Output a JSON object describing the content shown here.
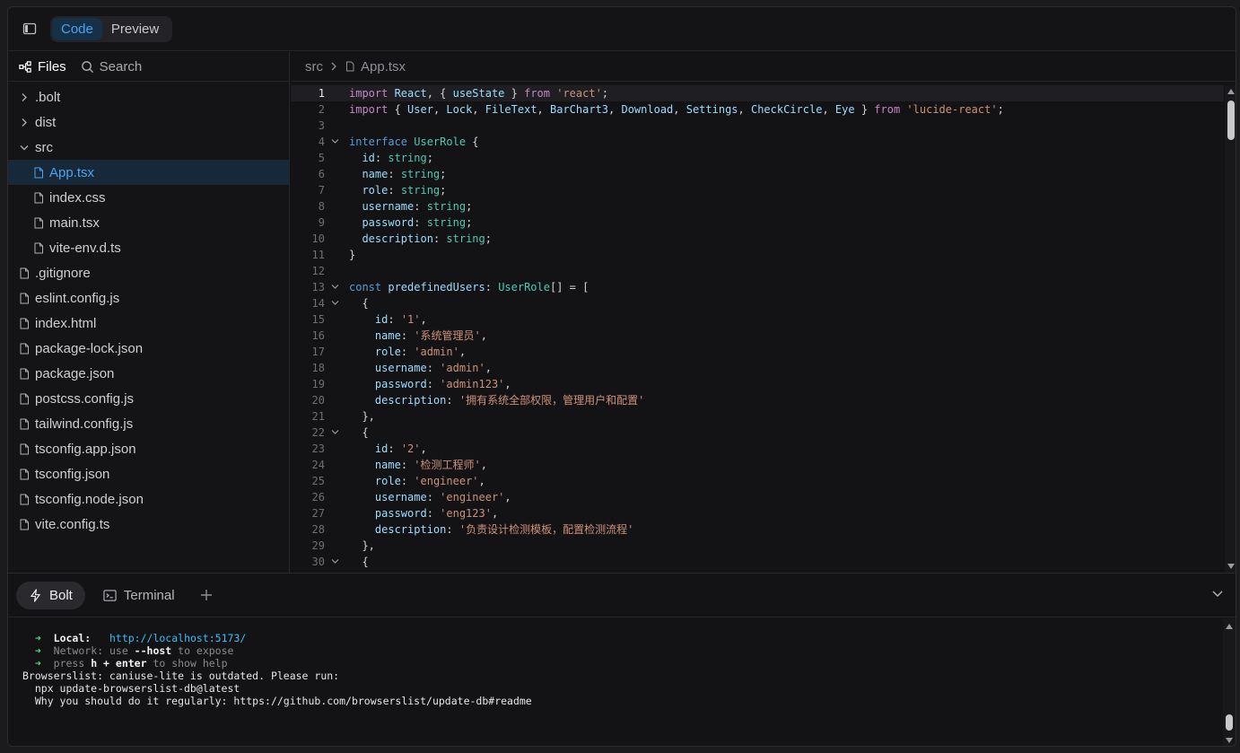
{
  "toolbar": {
    "tabs": [
      {
        "label": "Code",
        "active": true
      },
      {
        "label": "Preview",
        "active": false
      }
    ]
  },
  "files_panel": {
    "tabs": [
      {
        "label": "Files",
        "icon": "tree-icon",
        "active": true
      },
      {
        "label": "Search",
        "icon": "search-icon",
        "active": false
      }
    ],
    "tree": [
      {
        "label": ".bolt",
        "type": "folder",
        "expanded": false,
        "depth": 0
      },
      {
        "label": "dist",
        "type": "folder",
        "expanded": false,
        "depth": 0
      },
      {
        "label": "src",
        "type": "folder",
        "expanded": true,
        "depth": 0
      },
      {
        "label": "App.tsx",
        "type": "file",
        "depth": 1,
        "selected": true
      },
      {
        "label": "index.css",
        "type": "file",
        "depth": 1
      },
      {
        "label": "main.tsx",
        "type": "file",
        "depth": 1
      },
      {
        "label": "vite-env.d.ts",
        "type": "file",
        "depth": 1
      },
      {
        "label": ".gitignore",
        "type": "file",
        "depth": 0
      },
      {
        "label": "eslint.config.js",
        "type": "file",
        "depth": 0
      },
      {
        "label": "index.html",
        "type": "file",
        "depth": 0
      },
      {
        "label": "package-lock.json",
        "type": "file",
        "depth": 0
      },
      {
        "label": "package.json",
        "type": "file",
        "depth": 0
      },
      {
        "label": "postcss.config.js",
        "type": "file",
        "depth": 0
      },
      {
        "label": "tailwind.config.js",
        "type": "file",
        "depth": 0
      },
      {
        "label": "tsconfig.app.json",
        "type": "file",
        "depth": 0
      },
      {
        "label": "tsconfig.json",
        "type": "file",
        "depth": 0
      },
      {
        "label": "tsconfig.node.json",
        "type": "file",
        "depth": 0
      },
      {
        "label": "vite.config.ts",
        "type": "file",
        "depth": 0
      }
    ]
  },
  "editor": {
    "breadcrumb": {
      "folder": "src",
      "file": "App.tsx"
    },
    "current_line": 1,
    "lines": [
      {
        "n": "1",
        "fold": false,
        "tokens": [
          [
            "kw",
            "import "
          ],
          [
            "id",
            "React"
          ],
          [
            "pn",
            ", { "
          ],
          [
            "id",
            "useState"
          ],
          [
            "pn",
            " } "
          ],
          [
            "kw",
            "from "
          ],
          [
            "st",
            "'react'"
          ],
          [
            "pn",
            ";"
          ]
        ]
      },
      {
        "n": "2",
        "fold": false,
        "tokens": [
          [
            "kw",
            "import "
          ],
          [
            "pn",
            "{ "
          ],
          [
            "id",
            "User"
          ],
          [
            "pn",
            ", "
          ],
          [
            "id",
            "Lock"
          ],
          [
            "pn",
            ", "
          ],
          [
            "id",
            "FileText"
          ],
          [
            "pn",
            ", "
          ],
          [
            "id",
            "BarChart3"
          ],
          [
            "pn",
            ", "
          ],
          [
            "id",
            "Download"
          ],
          [
            "pn",
            ", "
          ],
          [
            "id",
            "Settings"
          ],
          [
            "pn",
            ", "
          ],
          [
            "id",
            "CheckCircle"
          ],
          [
            "pn",
            ", "
          ],
          [
            "id",
            "Eye"
          ],
          [
            "pn",
            " } "
          ],
          [
            "kw",
            "from "
          ],
          [
            "st",
            "'lucide-react'"
          ],
          [
            "pn",
            ";"
          ]
        ]
      },
      {
        "n": "3",
        "fold": false,
        "tokens": []
      },
      {
        "n": "4",
        "fold": true,
        "tokens": [
          [
            "kb",
            "interface "
          ],
          [
            "ty",
            "UserRole"
          ],
          [
            "pn",
            " {"
          ]
        ]
      },
      {
        "n": "5",
        "fold": false,
        "tokens": [
          [
            "pn",
            "  "
          ],
          [
            "id",
            "id"
          ],
          [
            "pn",
            ": "
          ],
          [
            "ty",
            "string"
          ],
          [
            "pn",
            ";"
          ]
        ]
      },
      {
        "n": "6",
        "fold": false,
        "tokens": [
          [
            "pn",
            "  "
          ],
          [
            "id",
            "name"
          ],
          [
            "pn",
            ": "
          ],
          [
            "ty",
            "string"
          ],
          [
            "pn",
            ";"
          ]
        ]
      },
      {
        "n": "7",
        "fold": false,
        "tokens": [
          [
            "pn",
            "  "
          ],
          [
            "id",
            "role"
          ],
          [
            "pn",
            ": "
          ],
          [
            "ty",
            "string"
          ],
          [
            "pn",
            ";"
          ]
        ]
      },
      {
        "n": "8",
        "fold": false,
        "tokens": [
          [
            "pn",
            "  "
          ],
          [
            "id",
            "username"
          ],
          [
            "pn",
            ": "
          ],
          [
            "ty",
            "string"
          ],
          [
            "pn",
            ";"
          ]
        ]
      },
      {
        "n": "9",
        "fold": false,
        "tokens": [
          [
            "pn",
            "  "
          ],
          [
            "id",
            "password"
          ],
          [
            "pn",
            ": "
          ],
          [
            "ty",
            "string"
          ],
          [
            "pn",
            ";"
          ]
        ]
      },
      {
        "n": "10",
        "fold": false,
        "tokens": [
          [
            "pn",
            "  "
          ],
          [
            "id",
            "description"
          ],
          [
            "pn",
            ": "
          ],
          [
            "ty",
            "string"
          ],
          [
            "pn",
            ";"
          ]
        ]
      },
      {
        "n": "11",
        "fold": false,
        "tokens": [
          [
            "pn",
            "}"
          ]
        ]
      },
      {
        "n": "12",
        "fold": false,
        "tokens": []
      },
      {
        "n": "13",
        "fold": true,
        "tokens": [
          [
            "kb",
            "const "
          ],
          [
            "id",
            "predefinedUsers"
          ],
          [
            "pn",
            ": "
          ],
          [
            "ty",
            "UserRole"
          ],
          [
            "pn",
            "[] = ["
          ]
        ]
      },
      {
        "n": "14",
        "fold": true,
        "tokens": [
          [
            "pn",
            "  {"
          ]
        ]
      },
      {
        "n": "15",
        "fold": false,
        "tokens": [
          [
            "pn",
            "    "
          ],
          [
            "id",
            "id"
          ],
          [
            "pn",
            ": "
          ],
          [
            "st",
            "'1'"
          ],
          [
            "pn",
            ","
          ]
        ]
      },
      {
        "n": "16",
        "fold": false,
        "tokens": [
          [
            "pn",
            "    "
          ],
          [
            "id",
            "name"
          ],
          [
            "pn",
            ": "
          ],
          [
            "st",
            "'系统管理员'"
          ],
          [
            "pn",
            ","
          ]
        ]
      },
      {
        "n": "17",
        "fold": false,
        "tokens": [
          [
            "pn",
            "    "
          ],
          [
            "id",
            "role"
          ],
          [
            "pn",
            ": "
          ],
          [
            "st",
            "'admin'"
          ],
          [
            "pn",
            ","
          ]
        ]
      },
      {
        "n": "18",
        "fold": false,
        "tokens": [
          [
            "pn",
            "    "
          ],
          [
            "id",
            "username"
          ],
          [
            "pn",
            ": "
          ],
          [
            "st",
            "'admin'"
          ],
          [
            "pn",
            ","
          ]
        ]
      },
      {
        "n": "19",
        "fold": false,
        "tokens": [
          [
            "pn",
            "    "
          ],
          [
            "id",
            "password"
          ],
          [
            "pn",
            ": "
          ],
          [
            "st",
            "'admin123'"
          ],
          [
            "pn",
            ","
          ]
        ]
      },
      {
        "n": "20",
        "fold": false,
        "tokens": [
          [
            "pn",
            "    "
          ],
          [
            "id",
            "description"
          ],
          [
            "pn",
            ": "
          ],
          [
            "st",
            "'拥有系统全部权限，管理用户和配置'"
          ]
        ]
      },
      {
        "n": "21",
        "fold": false,
        "tokens": [
          [
            "pn",
            "  },"
          ]
        ]
      },
      {
        "n": "22",
        "fold": true,
        "tokens": [
          [
            "pn",
            "  {"
          ]
        ]
      },
      {
        "n": "23",
        "fold": false,
        "tokens": [
          [
            "pn",
            "    "
          ],
          [
            "id",
            "id"
          ],
          [
            "pn",
            ": "
          ],
          [
            "st",
            "'2'"
          ],
          [
            "pn",
            ","
          ]
        ]
      },
      {
        "n": "24",
        "fold": false,
        "tokens": [
          [
            "pn",
            "    "
          ],
          [
            "id",
            "name"
          ],
          [
            "pn",
            ": "
          ],
          [
            "st",
            "'检测工程师'"
          ],
          [
            "pn",
            ","
          ]
        ]
      },
      {
        "n": "25",
        "fold": false,
        "tokens": [
          [
            "pn",
            "    "
          ],
          [
            "id",
            "role"
          ],
          [
            "pn",
            ": "
          ],
          [
            "st",
            "'engineer'"
          ],
          [
            "pn",
            ","
          ]
        ]
      },
      {
        "n": "26",
        "fold": false,
        "tokens": [
          [
            "pn",
            "    "
          ],
          [
            "id",
            "username"
          ],
          [
            "pn",
            ": "
          ],
          [
            "st",
            "'engineer'"
          ],
          [
            "pn",
            ","
          ]
        ]
      },
      {
        "n": "27",
        "fold": false,
        "tokens": [
          [
            "pn",
            "    "
          ],
          [
            "id",
            "password"
          ],
          [
            "pn",
            ": "
          ],
          [
            "st",
            "'eng123'"
          ],
          [
            "pn",
            ","
          ]
        ]
      },
      {
        "n": "28",
        "fold": false,
        "tokens": [
          [
            "pn",
            "    "
          ],
          [
            "id",
            "description"
          ],
          [
            "pn",
            ": "
          ],
          [
            "st",
            "'负责设计检测模板，配置检测流程'"
          ]
        ]
      },
      {
        "n": "29",
        "fold": false,
        "tokens": [
          [
            "pn",
            "  },"
          ]
        ]
      },
      {
        "n": "30",
        "fold": true,
        "tokens": [
          [
            "pn",
            "  {"
          ]
        ]
      }
    ]
  },
  "bottom_panel": {
    "tabs": [
      {
        "label": "Bolt",
        "icon": "bolt-icon",
        "active": true
      },
      {
        "label": "Terminal",
        "icon": "terminal-icon",
        "active": false
      }
    ],
    "terminal_lines": [
      [
        [
          "pn",
          "  "
        ],
        [
          "t-arrow",
          "➜"
        ],
        [
          "pn",
          "  "
        ],
        [
          "t-bold",
          "Local:"
        ],
        [
          "pn",
          "   "
        ],
        [
          "t-cyan",
          "http://localhost:5173/"
        ]
      ],
      [
        [
          "pn",
          "  "
        ],
        [
          "t-arrow",
          "➜"
        ],
        [
          "pn",
          "  "
        ],
        [
          "t-dim",
          "Network: use "
        ],
        [
          "t-bold",
          "--host"
        ],
        [
          "t-dim",
          " to expose"
        ]
      ],
      [
        [
          "pn",
          "  "
        ],
        [
          "t-arrow",
          "➜"
        ],
        [
          "pn",
          "  "
        ],
        [
          "t-dim",
          "press "
        ],
        [
          "t-bold",
          "h + enter"
        ],
        [
          "t-dim",
          " to show help"
        ]
      ],
      [
        [
          "t-plain",
          "Browserslist: caniuse-lite is outdated. Please run:"
        ]
      ],
      [
        [
          "t-plain",
          "  npx update-browserslist-db@latest"
        ]
      ],
      [
        [
          "t-plain",
          "  Why you should do it regularly: https://github.com/browserslist/update-db#readme"
        ]
      ]
    ]
  },
  "colors": {
    "accent": "#4aa3f5",
    "selected_bg": "#172838",
    "background": "#131316",
    "border": "#26262a"
  }
}
